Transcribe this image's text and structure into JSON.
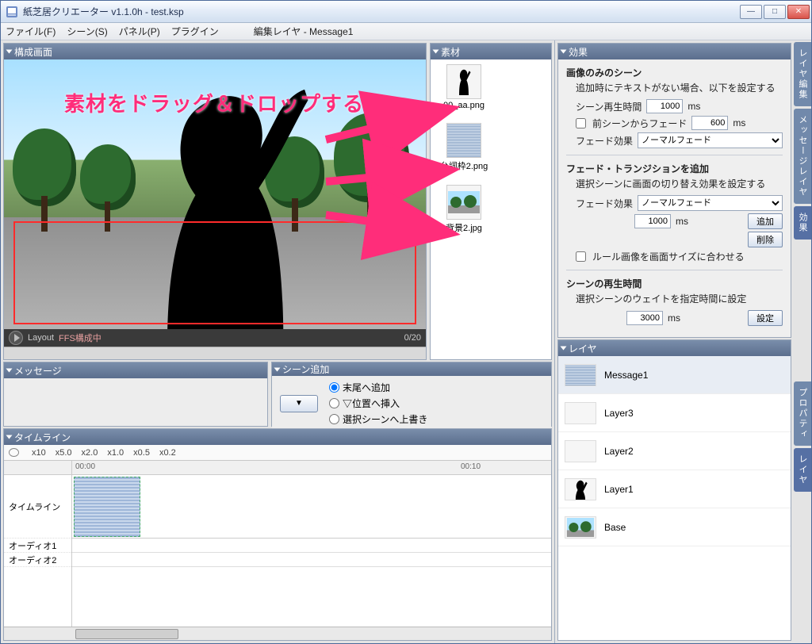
{
  "window": {
    "title": "紙芝居クリエーター v1.1.0h - test.ksp"
  },
  "menu": {
    "file": "ファイル(F)",
    "scene": "シーン(S)",
    "panel": "パネル(P)",
    "plugin": "プラグイン",
    "editLayer": "編集レイヤ - Message1"
  },
  "panels": {
    "composition": "構成画面",
    "assets": "素材",
    "effects": "効果",
    "message": "メッセージ",
    "sceneAdd": "シーン追加",
    "timeline": "タイムライン",
    "layers": "レイヤ"
  },
  "overlay": {
    "hint": "素材をドラッグ＆ドロップする"
  },
  "playbar": {
    "layout": "Layout",
    "status": "FFS構成中",
    "frame": "0/20"
  },
  "assets": [
    {
      "name": "00_aa.png"
    },
    {
      "name": "台詞枠2.png"
    },
    {
      "name": "背景2.jpg"
    }
  ],
  "sceneAdd": {
    "opt1": "末尾へ追加",
    "opt2": "▽位置へ挿入",
    "opt3": "選択シーンへ上書き",
    "selected": "opt1"
  },
  "timeline": {
    "zoom": [
      "x10",
      "x5.0",
      "x2.0",
      "x1.0",
      "x0.5",
      "x0.2"
    ],
    "tick1": "00:00",
    "tick2": "00:10",
    "rowTimeline": "タイムライン",
    "rowAudio1": "オーディオ1",
    "rowAudio2": "オーディオ2"
  },
  "effects": {
    "sec1": "画像のみのシーン",
    "sec1desc": "追加時にテキストがない場合、以下を設定する",
    "playTimeLabel": "シーン再生時間",
    "playTime": "1000",
    "ms": "ms",
    "fadePrevLabel": "前シーンからフェード",
    "fadePrev": "600",
    "fadeEffLabel": "フェード効果",
    "fadeEffVal": "ノーマルフェード",
    "sec2": "フェード・トランジションを追加",
    "sec2desc": "選択シーンに画面の切り替え効果を設定する",
    "transTime": "1000",
    "addBtn": "追加",
    "delBtn": "削除",
    "ruleImg": "ルール画像を画面サイズに合わせる",
    "sec3": "シーンの再生時間",
    "sec3desc": "選択シーンのウェイトを指定時間に設定",
    "sceneTime": "3000",
    "setBtn": "設定"
  },
  "layers": [
    {
      "name": "Message1",
      "sel": true
    },
    {
      "name": "Layer3"
    },
    {
      "name": "Layer2"
    },
    {
      "name": "Layer1"
    },
    {
      "name": "Base"
    }
  ],
  "sideTabs": {
    "t1": "レイヤ編集",
    "t2": "メッセージレイヤ",
    "t3": "効果",
    "t4": "プロパティ",
    "t5": "レイヤ"
  }
}
